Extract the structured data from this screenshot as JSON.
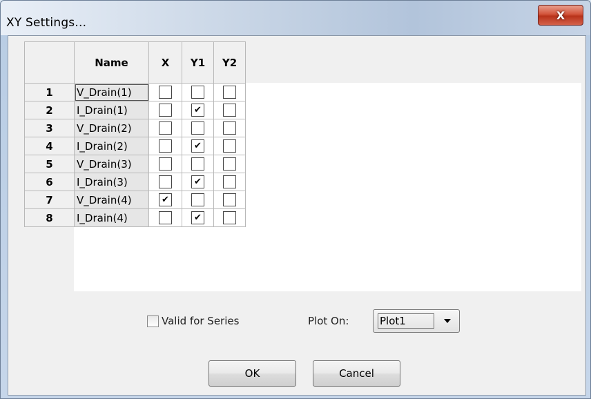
{
  "window": {
    "title": "XY Settings...",
    "close_label": "X"
  },
  "grid": {
    "columns": [
      "Name",
      "X",
      "Y1",
      "Y2"
    ],
    "rows": [
      {
        "num": "1",
        "name": "V_Drain(1)",
        "x": false,
        "y1": false,
        "y2": false
      },
      {
        "num": "2",
        "name": "I_Drain(1)",
        "x": false,
        "y1": true,
        "y2": false
      },
      {
        "num": "3",
        "name": "V_Drain(2)",
        "x": false,
        "y1": false,
        "y2": false
      },
      {
        "num": "4",
        "name": "I_Drain(2)",
        "x": false,
        "y1": true,
        "y2": false
      },
      {
        "num": "5",
        "name": "V_Drain(3)",
        "x": false,
        "y1": false,
        "y2": false
      },
      {
        "num": "6",
        "name": "I_Drain(3)",
        "x": false,
        "y1": true,
        "y2": false
      },
      {
        "num": "7",
        "name": "V_Drain(4)",
        "x": true,
        "y1": false,
        "y2": false
      },
      {
        "num": "8",
        "name": "I_Drain(4)",
        "x": false,
        "y1": true,
        "y2": false
      }
    ]
  },
  "options": {
    "valid_for_series_label": "Valid for Series",
    "valid_for_series_checked": false,
    "plot_on_label": "Plot On:",
    "plot_on_value": "Plot1"
  },
  "buttons": {
    "ok_label": "OK",
    "cancel_label": "Cancel"
  },
  "icons": {
    "close": "close-icon",
    "dropdown": "chevron-down-icon",
    "check": "checkmark-icon"
  },
  "colors": {
    "close_button": "#c8442b",
    "titlebar": "#c9d6e6",
    "dialog_bg": "#f0f0f0"
  }
}
